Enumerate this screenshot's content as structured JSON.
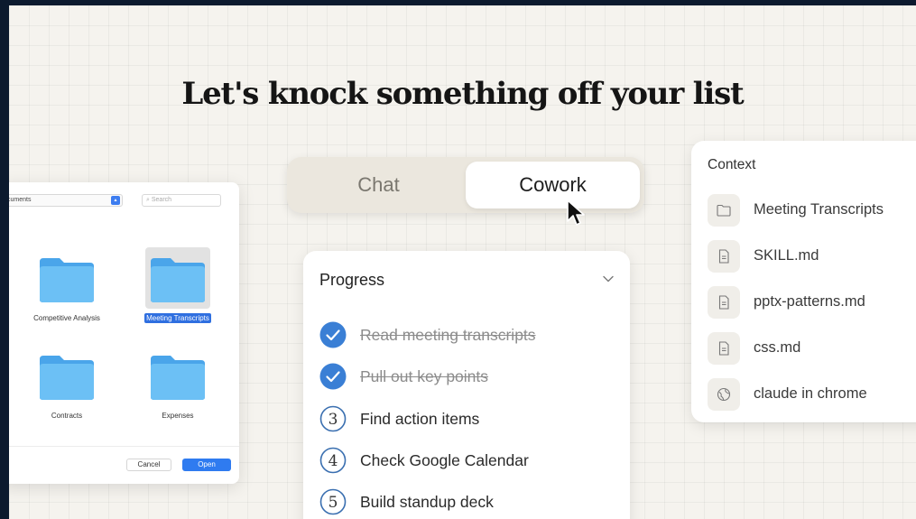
{
  "headline": "Let's knock something off your list",
  "file_dialog": {
    "location": "cuments",
    "search_placeholder": "Search",
    "folders": [
      {
        "label": "Competitive Analysis",
        "selected": false
      },
      {
        "label": "Meeting Transcripts",
        "selected": true
      },
      {
        "label": "Contracts",
        "selected": false
      },
      {
        "label": "Expenses",
        "selected": false
      }
    ],
    "cancel_label": "Cancel",
    "open_label": "Open"
  },
  "mode_toggle": {
    "options": [
      "Chat",
      "Cowork"
    ],
    "selected": "Cowork"
  },
  "progress": {
    "title": "Progress",
    "tasks": [
      {
        "label": "Read meeting transcripts",
        "status": "done",
        "marker": "check"
      },
      {
        "label": "Pull out key points",
        "status": "done",
        "marker": "check"
      },
      {
        "label": "Find action items",
        "status": "todo",
        "marker": "3"
      },
      {
        "label": "Check Google Calendar",
        "status": "todo",
        "marker": "4"
      },
      {
        "label": "Build standup deck",
        "status": "todo",
        "marker": "5"
      }
    ]
  },
  "context": {
    "title": "Context",
    "items": [
      {
        "label": "Meeting Transcripts",
        "icon": "folder-icon"
      },
      {
        "label": "SKILL.md",
        "icon": "document-icon"
      },
      {
        "label": "pptx-patterns.md",
        "icon": "document-icon"
      },
      {
        "label": "css.md",
        "icon": "document-icon"
      },
      {
        "label": "claude in chrome",
        "icon": "globe-icon"
      }
    ]
  },
  "colors": {
    "accent_blue": "#2f7bf0",
    "check_blue": "#3a7fd5",
    "background": "#f5f3ee",
    "folder_blue": "#5db3f0"
  }
}
